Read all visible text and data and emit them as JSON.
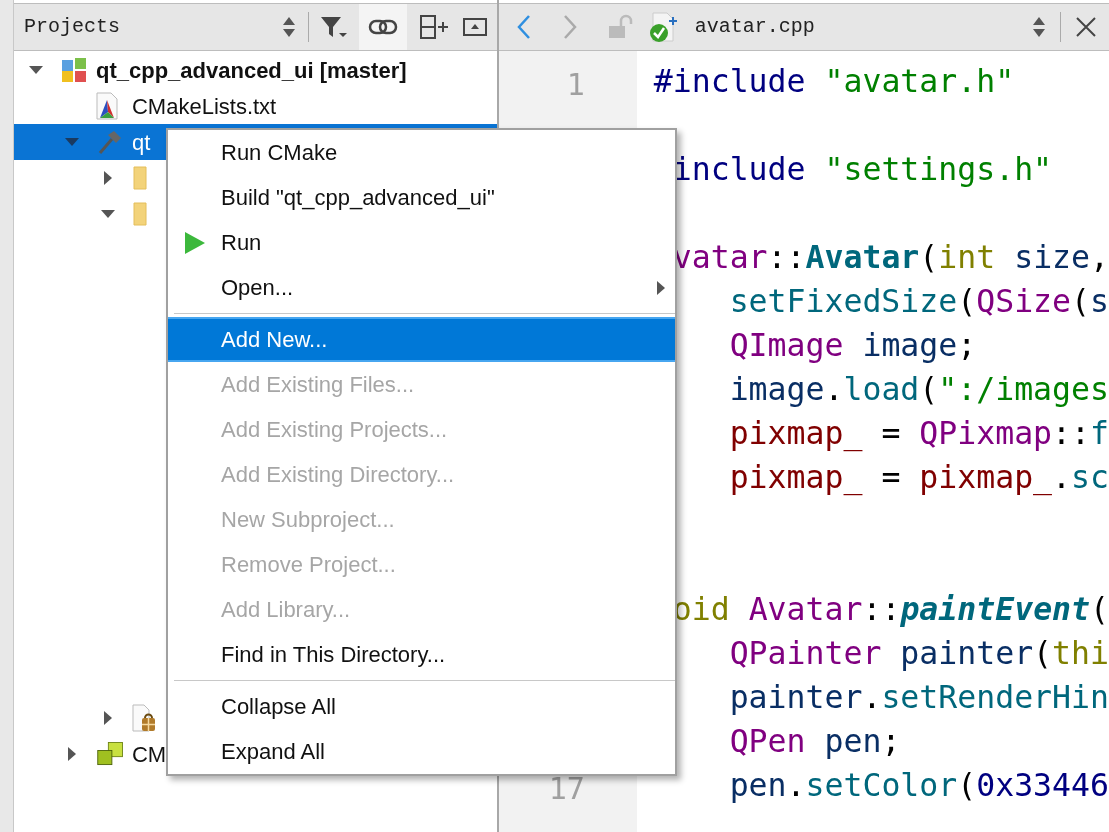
{
  "panel": {
    "title": "Projects"
  },
  "tree": [
    {
      "label": "qt_cpp_advanced_ui [master]",
      "kind": "project",
      "expanded": true,
      "selected": false,
      "children": [
        {
          "label": "CMakeLists.txt",
          "kind": "cmake_file",
          "selected": false
        },
        {
          "label": "qt",
          "kind": "target",
          "expanded": true,
          "selected": true,
          "children": [
            {
              "kind": "folder",
              "expanded": false,
              "selected": false
            },
            {
              "kind": "folder",
              "expanded": true,
              "selected": false
            },
            {
              "kind": "resource_file",
              "expanded": false,
              "selected": false
            }
          ]
        },
        {
          "label": "CM",
          "kind": "cmake_modules",
          "expanded": false,
          "selected": false
        }
      ]
    }
  ],
  "editor": {
    "file_name": "avatar.cpp",
    "lines": [
      {
        "kind": "code",
        "number": "1",
        "tokens": [
          {
            "text": "#include ",
            "kind": "preproc"
          },
          {
            "text": "\"avatar.h\"",
            "kind": "string"
          }
        ]
      },
      {
        "kind": "blank"
      },
      {
        "kind": "code",
        "tokens": [
          {
            "text": " include ",
            "kind": "preproc"
          },
          {
            "text": "\"settings.h\"",
            "kind": "string"
          }
        ]
      },
      {
        "kind": "blank"
      },
      {
        "kind": "code",
        "tokens": [
          {
            "text": " vatar",
            "kind": "type"
          },
          {
            "text": "::",
            "kind": "punct"
          },
          {
            "text": "Avatar",
            "kind": "func_decl"
          },
          {
            "text": "(",
            "kind": "punct"
          },
          {
            "text": "int",
            "kind": "keyword"
          },
          {
            "text": " size",
            "kind": "local"
          },
          {
            "text": ",",
            "kind": "punct"
          }
        ]
      },
      {
        "kind": "code",
        "tokens": [
          {
            "text": "    setFixedSize",
            "kind": "call"
          },
          {
            "text": "(",
            "kind": "punct"
          },
          {
            "text": "QSize",
            "kind": "type"
          },
          {
            "text": "(",
            "kind": "punct"
          },
          {
            "text": "s",
            "kind": "local"
          }
        ]
      },
      {
        "kind": "code",
        "tokens": [
          {
            "text": "    QImage",
            "kind": "type"
          },
          {
            "text": " image",
            "kind": "local"
          },
          {
            "text": ";",
            "kind": "punct"
          }
        ]
      },
      {
        "kind": "code",
        "tokens": [
          {
            "text": "    image",
            "kind": "local"
          },
          {
            "text": ".",
            "kind": "punct"
          },
          {
            "text": "load",
            "kind": "call"
          },
          {
            "text": "(",
            "kind": "punct"
          },
          {
            "text": "\":/images",
            "kind": "string"
          }
        ]
      },
      {
        "kind": "code",
        "tokens": [
          {
            "text": "    pixmap_",
            "kind": "member"
          },
          {
            "text": " = ",
            "kind": "punct"
          },
          {
            "text": "QPixmap",
            "kind": "type"
          },
          {
            "text": "::",
            "kind": "punct"
          },
          {
            "text": "f",
            "kind": "call"
          }
        ]
      },
      {
        "kind": "code",
        "tokens": [
          {
            "text": "    pixmap_",
            "kind": "member"
          },
          {
            "text": " = ",
            "kind": "punct"
          },
          {
            "text": "pixmap_",
            "kind": "member"
          },
          {
            "text": ".",
            "kind": "punct"
          },
          {
            "text": "sc",
            "kind": "call"
          }
        ]
      },
      {
        "kind": "blank"
      },
      {
        "kind": "blank"
      },
      {
        "kind": "code",
        "tokens": [
          {
            "text": " oid",
            "kind": "keyword"
          },
          {
            "text": " Avatar",
            "kind": "type"
          },
          {
            "text": "::",
            "kind": "punct"
          },
          {
            "text": "paintEvent",
            "kind": "virtual"
          },
          {
            "text": "(",
            "kind": "punct"
          }
        ]
      },
      {
        "kind": "code",
        "tokens": [
          {
            "text": "    QPainter",
            "kind": "type"
          },
          {
            "text": " painter",
            "kind": "local"
          },
          {
            "text": "(",
            "kind": "punct"
          },
          {
            "text": "thi",
            "kind": "keyword"
          }
        ]
      },
      {
        "kind": "code",
        "tokens": [
          {
            "text": "    painter",
            "kind": "local"
          },
          {
            "text": ".",
            "kind": "punct"
          },
          {
            "text": "setRenderHin",
            "kind": "call"
          }
        ]
      },
      {
        "kind": "code",
        "tokens": [
          {
            "text": "    QPen",
            "kind": "type"
          },
          {
            "text": " pen",
            "kind": "local"
          },
          {
            "text": ";",
            "kind": "punct"
          }
        ]
      },
      {
        "kind": "code",
        "number": "17",
        "tokens": [
          {
            "text": "    pen",
            "kind": "local"
          },
          {
            "text": ".",
            "kind": "punct"
          },
          {
            "text": "setColor",
            "kind": "call"
          },
          {
            "text": "(",
            "kind": "punct"
          },
          {
            "text": "0x33446",
            "kind": "number"
          }
        ]
      }
    ]
  },
  "context_menu": [
    {
      "kind": "item",
      "label": "Run CMake",
      "disabled": false,
      "selected": false
    },
    {
      "kind": "item",
      "label": "Build \"qt_cpp_advanced_ui\"",
      "disabled": false,
      "selected": false
    },
    {
      "kind": "play_item",
      "label": "Run",
      "disabled": false,
      "selected": false
    },
    {
      "kind": "submenu",
      "label": "Open...",
      "disabled": false,
      "selected": false
    },
    {
      "kind": "separator"
    },
    {
      "kind": "item",
      "label": "Add New...",
      "disabled": false,
      "selected": true
    },
    {
      "kind": "item",
      "label": "Add Existing Files...",
      "disabled": true,
      "selected": false
    },
    {
      "kind": "item",
      "label": "Add Existing Projects...",
      "disabled": true,
      "selected": false
    },
    {
      "kind": "item",
      "label": "Add Existing Directory...",
      "disabled": true,
      "selected": false
    },
    {
      "kind": "item",
      "label": "New Subproject...",
      "disabled": true,
      "selected": false
    },
    {
      "kind": "item",
      "label": "Remove Project...",
      "disabled": true,
      "selected": false
    },
    {
      "kind": "item",
      "label": "Add Library...",
      "disabled": true,
      "selected": false
    },
    {
      "kind": "item",
      "label": "Find in This Directory...",
      "disabled": false,
      "selected": false
    },
    {
      "kind": "separator"
    },
    {
      "kind": "item",
      "label": "Collapse All",
      "disabled": false,
      "selected": false
    },
    {
      "kind": "item",
      "label": "Expand All",
      "disabled": false,
      "selected": false
    }
  ]
}
